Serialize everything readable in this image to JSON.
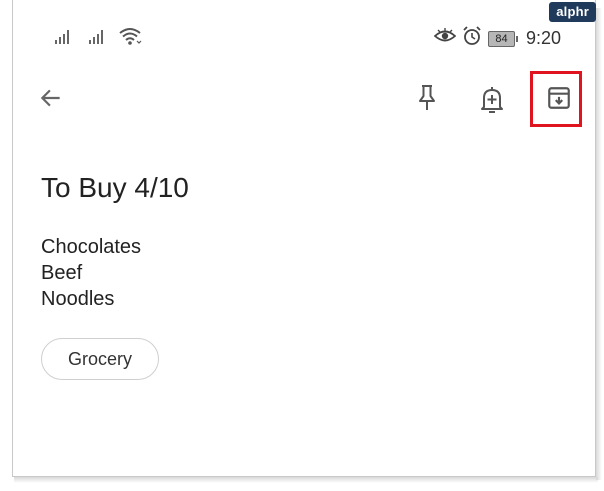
{
  "watermark": "alphr",
  "status_bar": {
    "battery_level": "84",
    "time": "9:20",
    "icons": [
      "signal-icon",
      "signal-icon",
      "wifi-icon",
      "eye-icon",
      "alarm-icon",
      "battery-icon"
    ]
  },
  "toolbar": {
    "icons": [
      "back-arrow-icon",
      "pin-icon",
      "add-reminder-icon",
      "archive-icon"
    ],
    "highlight_color": "#e0141e"
  },
  "note": {
    "title": "To Buy 4/10",
    "lines": [
      "Chocolates",
      "Beef",
      "Noodles"
    ],
    "label_chip": "Grocery"
  }
}
